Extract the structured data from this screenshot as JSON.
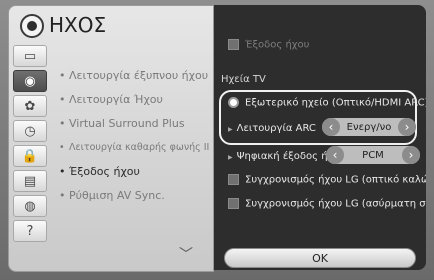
{
  "header": {
    "title": "ΗΧΟΣ",
    "icon": "sound-icon"
  },
  "categories": [
    {
      "icon": "monitor-icon",
      "glyph": "▭"
    },
    {
      "icon": "sound-icon",
      "glyph": "◉"
    },
    {
      "icon": "channel-icon",
      "glyph": "✿"
    },
    {
      "icon": "clock-icon",
      "glyph": "◷"
    },
    {
      "icon": "lock-icon",
      "glyph": "🔒"
    },
    {
      "icon": "options-icon",
      "glyph": "▤"
    },
    {
      "icon": "network-icon",
      "glyph": "◍"
    },
    {
      "icon": "support-icon",
      "glyph": "?"
    }
  ],
  "menu": {
    "items": [
      "Λειτουργία έξυπνου ήχου",
      "Λειτουργία Ήχου",
      "Virtual Surround Plus",
      "Λειτουργία καθαρής φωνής II",
      "Έξοδος ήχου",
      "Ρύθμιση AV Sync."
    ]
  },
  "panel": {
    "top_option": "Έξοδος ήχου",
    "section_label": "Ηχεία TV",
    "external_speaker": "Εξωτερικό ηχείο (Οπτικό/HDMI ARC)",
    "arc_label": "Λειτουργία ARC",
    "arc_value": "Ενεργ/νο",
    "digital_label": "Ψηφιακή έξοδος ήχου",
    "digital_value": "PCM",
    "lg_sync_optical": "Συγχρονισμός ήχου LG (οπτικό καλώδιο)",
    "lg_sync_wireless": "Συγχρονισμός ήχου LG (ασύρματη σύνδεση)",
    "ok_label": "OK"
  }
}
